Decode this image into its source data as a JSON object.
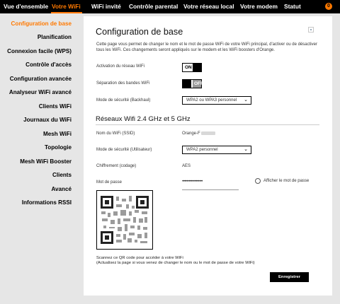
{
  "topnav": {
    "tabs": [
      {
        "label": "Vue d'ensemble"
      },
      {
        "label": "Votre WiFi"
      },
      {
        "label": "WiFi invité"
      },
      {
        "label": "Contrôle parental"
      },
      {
        "label": "Votre réseau local"
      },
      {
        "label": "Votre modem"
      },
      {
        "label": "Statut"
      }
    ],
    "notification_count": "0"
  },
  "sidebar": {
    "items": [
      {
        "label": "Configuration de base"
      },
      {
        "label": "Planification"
      },
      {
        "label": "Connexion facile (WPS)"
      },
      {
        "label": "Contrôle d'accès"
      },
      {
        "label": "Configuration avancée"
      },
      {
        "label": "Analyseur WiFi avancé"
      },
      {
        "label": "Clients WiFi"
      },
      {
        "label": "Journaux du WiFi"
      },
      {
        "label": "Mesh WiFi"
      },
      {
        "label": "Topologie"
      },
      {
        "label": "Mesh WiFi Booster"
      },
      {
        "label": "Clients"
      },
      {
        "label": "Avancé"
      },
      {
        "label": "Informations RSSI"
      }
    ]
  },
  "main": {
    "title": "Configuration de base",
    "description": "Cette page vous permet de changer le nom et le mot de passe WiFi de votre WiFi principal, d'activer ou de désactiver tous les WiFi. Ces changements seront appliqués sur le modem et les WiFi boosters d'Orange.",
    "wifi_activation": {
      "label": "Activation du réseau WiFi",
      "state": "ON"
    },
    "band_separation": {
      "label": "Séparation des bandes WiFi",
      "state": "OFF"
    },
    "backhaul_security": {
      "label": "Mode de sécurité (Backhaul)",
      "value": "WPA2 ou WPA3 personnel"
    },
    "section_title": "Réseaux Wifi 2.4 GHz et 5 GHz",
    "ssid": {
      "label": "Nom du WiFi (SSID)",
      "value": "Orange-F"
    },
    "user_security": {
      "label": "Mode de sécurité (Utilisateur)",
      "value": "WPA2 personnel"
    },
    "encryption": {
      "label": "Chiffrement (codage)",
      "value": "AES"
    },
    "password": {
      "label": "Mot de passe",
      "value": "••••••••••••••••••",
      "show_label": "Afficher le mot de passe"
    },
    "qr_note_line1": "Scannez ce QR code pour accéder à votre WiFi",
    "qr_note_line2": "(Actualisez la page si vous venez de changer le nom ou le mot de passe de votre WiFi)",
    "save_label": "Enregistrer"
  },
  "colors": {
    "accent": "#ff7900",
    "nav_bg": "#000000",
    "page_bg": "#e6e6e6"
  }
}
